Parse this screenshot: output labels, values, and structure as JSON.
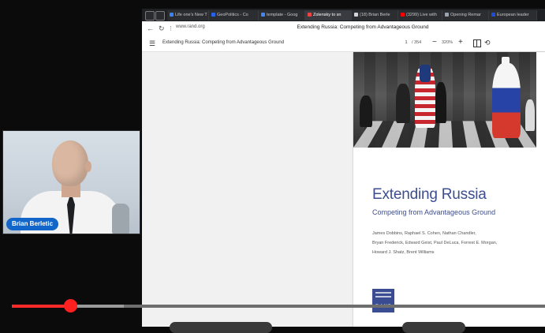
{
  "webcam": {
    "name_badge": "Brian Berletic"
  },
  "browser": {
    "tabs": [
      {
        "label": "Life one's New T",
        "color": "#3b82f6"
      },
      {
        "label": "GeoPolitics - Co",
        "color": "#2563eb"
      },
      {
        "label": "template - Goog",
        "color": "#4285f4"
      },
      {
        "label": "Zolensky to sn",
        "color": "#ef4444"
      },
      {
        "label": "(18) Brian Berle",
        "color": "#1f2937"
      },
      {
        "label": "(3299) Live with",
        "color": "#ff0000"
      },
      {
        "label": "Opening Remar",
        "color": "#9ca3af"
      },
      {
        "label": "European leader",
        "color": "#1d4ed8"
      }
    ],
    "url": "www.rand.org",
    "window_title": "Extending Russia: Competing from Advantageous Ground"
  },
  "pdf": {
    "title": "Extending Russia: Competing from Advantageous Ground",
    "page_current": "1",
    "page_total": "/ 354",
    "zoom": "320%",
    "cover": {
      "title": "Extending Russia",
      "subtitle": "Competing from Advantageous Ground",
      "authors": [
        "James Dobbins, Raphael S. Cohen, Nathan Chandler,",
        "Bryan Frederick, Edward Geist, Paul DeLuca, Forrest E. Morgan,",
        "Howard J. Shatz, Brent Williams"
      ],
      "publisher": "RAND"
    }
  },
  "video": {
    "progress_fraction": 0.11,
    "buffered_fraction": 0.21
  },
  "colors": {
    "accent": "#ff2a2a",
    "title_blue": "#3d4e8f",
    "badge_blue": "#1366c9"
  }
}
